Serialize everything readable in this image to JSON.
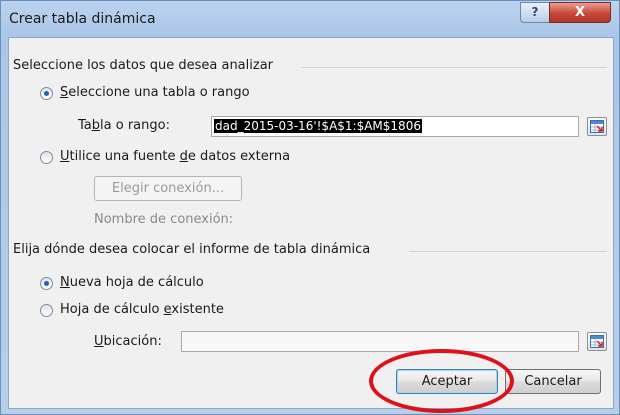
{
  "window": {
    "title": "Crear tabla dinámica",
    "help_glyph": "?",
    "close_glyph": "X"
  },
  "source": {
    "section_label": "Seleccione los datos que desea analizar",
    "option_table": "Seleccione una tabla o rango",
    "range_label": "Tabla o rango:",
    "range_value": "dad_2015-03-16'!$A$1:$AM$1806",
    "option_external": "Utilice una fuente de datos externa",
    "connection_button": "Elegir conexión...",
    "connection_name_label": "Nombre de conexión:"
  },
  "destination": {
    "section_label": "Elija dónde desea colocar el informe de tabla dinámica",
    "option_new_sheet": "Nueva hoja de cálculo",
    "option_existing_sheet": "Hoja de cálculo existente",
    "location_label": "Ubicación:",
    "location_value": ""
  },
  "buttons": {
    "accept": "Aceptar",
    "cancel": "Cancelar"
  },
  "state": {
    "selected_source": "table",
    "selected_destination": "new_sheet"
  },
  "colors": {
    "annotation": "#e0101a",
    "selection_bg": "#000000",
    "radio_dot": "#2a5fb0"
  }
}
